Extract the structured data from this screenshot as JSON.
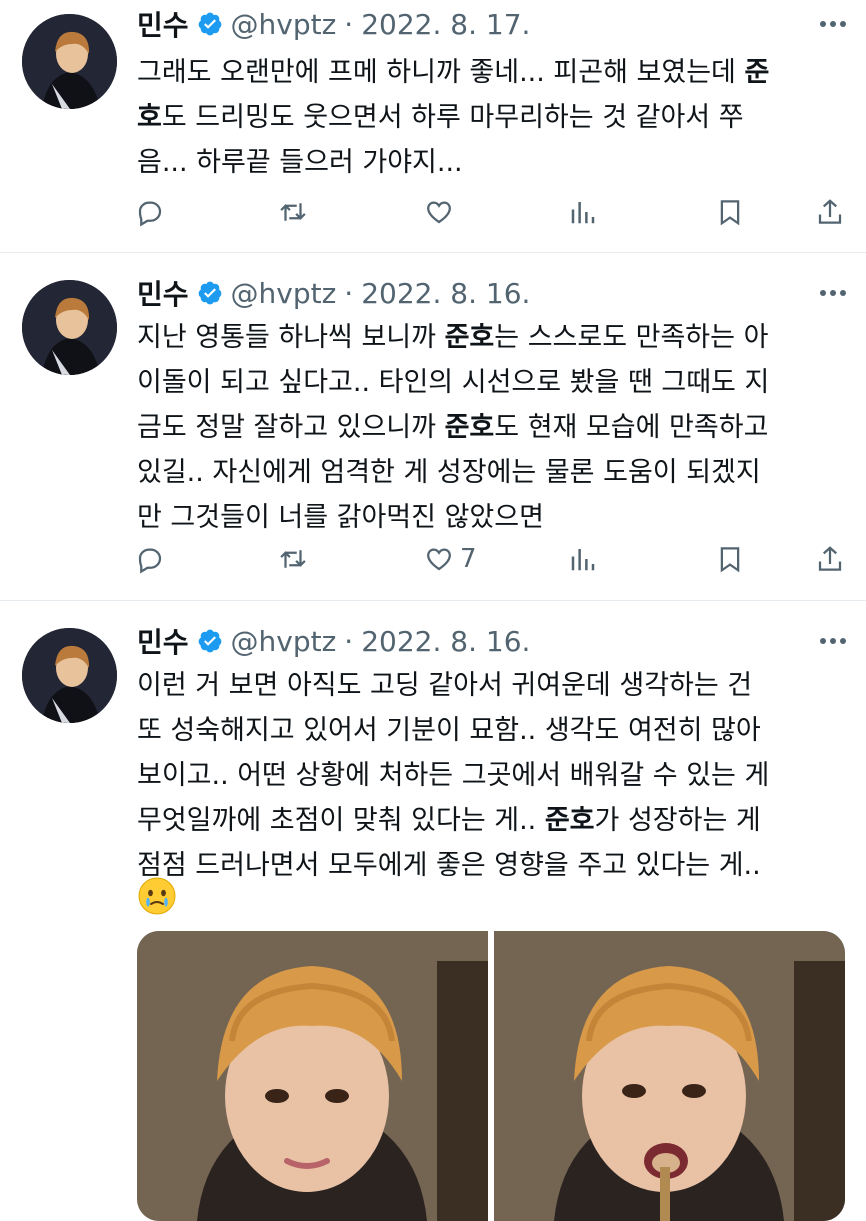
{
  "tweets": [
    {
      "author": "민수",
      "handle": "@hvptz",
      "separator": "·",
      "date": "2022. 8. 17.",
      "lines": [
        [
          {
            "t": "그래도 오랜만에 프메 하니까 좋네... 피곤해 보였는데 "
          },
          {
            "t": "준",
            "b": true
          }
        ],
        [
          {
            "t": "호",
            "b": true
          },
          {
            "t": "도 드리밍도 웃으면서 하루 마무리하는 것 같아서 쭈"
          }
        ],
        [
          {
            "t": "음... 하루끝 들으러 가야지..."
          }
        ]
      ],
      "like_count": ""
    },
    {
      "author": "민수",
      "handle": "@hvptz",
      "separator": "·",
      "date": "2022. 8. 16.",
      "lines": [
        [
          {
            "t": "지난 영통들 하나씩 보니까 "
          },
          {
            "t": "준호",
            "b": true
          },
          {
            "t": "는 스스로도 만족하는 아"
          }
        ],
        [
          {
            "t": "이돌이 되고 싶다고.. 타인의 시선으로 봤을 땐 그때도 지"
          }
        ],
        [
          {
            "t": "금도 정말 잘하고 있으니까 "
          },
          {
            "t": "준호",
            "b": true
          },
          {
            "t": "도 현재 모습에 만족하고"
          }
        ],
        [
          {
            "t": "있길.. 자신에게 엄격한 게 성장에는 물론 도움이 되겠지"
          }
        ],
        [
          {
            "t": "만 그것들이 너를 갉아먹진 않았으면"
          }
        ]
      ],
      "like_count": "7"
    },
    {
      "author": "민수",
      "handle": "@hvptz",
      "separator": "·",
      "date": "2022. 8. 16.",
      "lines": [
        [
          {
            "t": "이런 거 보면 아직도 고딩 같아서 귀여운데 생각하는 건"
          }
        ],
        [
          {
            "t": "또 성숙해지고 있어서 기분이 묘함.. 생각도 여전히 많아"
          }
        ],
        [
          {
            "t": "보이고.. 어떤 상황에 처하든 그곳에서 배워갈 수 있는 게"
          }
        ],
        [
          {
            "t": "무엇일까에 초점이 맞춰 있다는 게.. "
          },
          {
            "t": "준호",
            "b": true
          },
          {
            "t": "가 성장하는 게"
          }
        ],
        [
          {
            "t": "점점 드러나면서 모두에게 좋은 영향을 주고 있다는 게.."
          }
        ]
      ],
      "emoji": "face-holding-back-tears",
      "like_count": ""
    }
  ],
  "icons": {
    "reply": "reply-icon",
    "retweet": "retweet-icon",
    "like": "like-icon",
    "views": "views-icon",
    "bookmark": "bookmark-icon",
    "share": "share-icon",
    "verified": "verified-badge-icon",
    "more": "more-icon"
  },
  "colors": {
    "text": "#0f1419",
    "secondary": "#536471",
    "verified": "#1d9bf0",
    "divider": "#e6ecf0"
  }
}
